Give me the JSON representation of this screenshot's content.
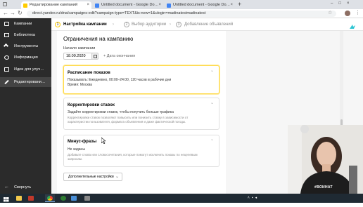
{
  "browser": {
    "tabs": [
      {
        "label": "Редактирование кампаний",
        "fav_color": "#ffcc00"
      },
      {
        "label": "Untitled document - Google Do…",
        "fav_color": "#4285f4"
      },
      {
        "label": "Untitled document - Google Do…",
        "fav_color": "#4285f4"
      }
    ],
    "url": "direct.yandex.ru/dna/campaigns-edit?campaign-type=TEXT&is-new=1&ulogin=madinatestmadinatest"
  },
  "sidebar": {
    "items": [
      {
        "label": "Кампании",
        "icon": "campaigns-icon"
      },
      {
        "label": "Библиотека",
        "icon": "library-icon"
      },
      {
        "label": "Инструменты",
        "icon": "tools-icon"
      },
      {
        "label": "Информация",
        "icon": "info-icon"
      },
      {
        "label": "Идеи для улуч…",
        "icon": "ideas-icon"
      },
      {
        "label": "Редактировани…",
        "icon": "edit-icon"
      }
    ],
    "collapse_label": "Свернуть"
  },
  "steps": [
    {
      "num": "1",
      "label": "Настройка кампании",
      "active": true
    },
    {
      "num": "2",
      "label": "Выбор аудитории",
      "active": false
    },
    {
      "num": "3",
      "label": "Добавление объявлений",
      "active": false
    }
  ],
  "restrictions": {
    "title": "Ограничения на кампанию",
    "start_label": "Начало кампании",
    "start_value": "18.09.2020",
    "end_label": "+ Дата окончания"
  },
  "cards": {
    "schedule": {
      "title": "Расписание показов",
      "line1": "Показывать: Ежедневно, 00:00–24:00, 120 часов в рабочие дни",
      "line2": "Время: Москва"
    },
    "bids": {
      "title": "Корректировки ставок",
      "line1": "Задайте корректировки ставок, чтобы получить больше трафика",
      "desc1": "Корректировки ставок позволяют повысить или понизить ставку в зависимости от",
      "desc2": "характеристик пользователя, формата объявления и даже фактической погоды."
    },
    "minus": {
      "title": "Минус-фразы",
      "value": "Не заданы",
      "desc1": "Добавьте слова или словосочетания, которые помогут исключить показы по нецелевым",
      "desc2": "запросам."
    }
  },
  "more_settings_label": "Дополнительные настройки",
  "webcam_caption": "#ВОИНАТ",
  "colors": {
    "accent": "#ffcc00",
    "sidebar": "#2b2b2b",
    "taskbar": "#1f2a33"
  }
}
